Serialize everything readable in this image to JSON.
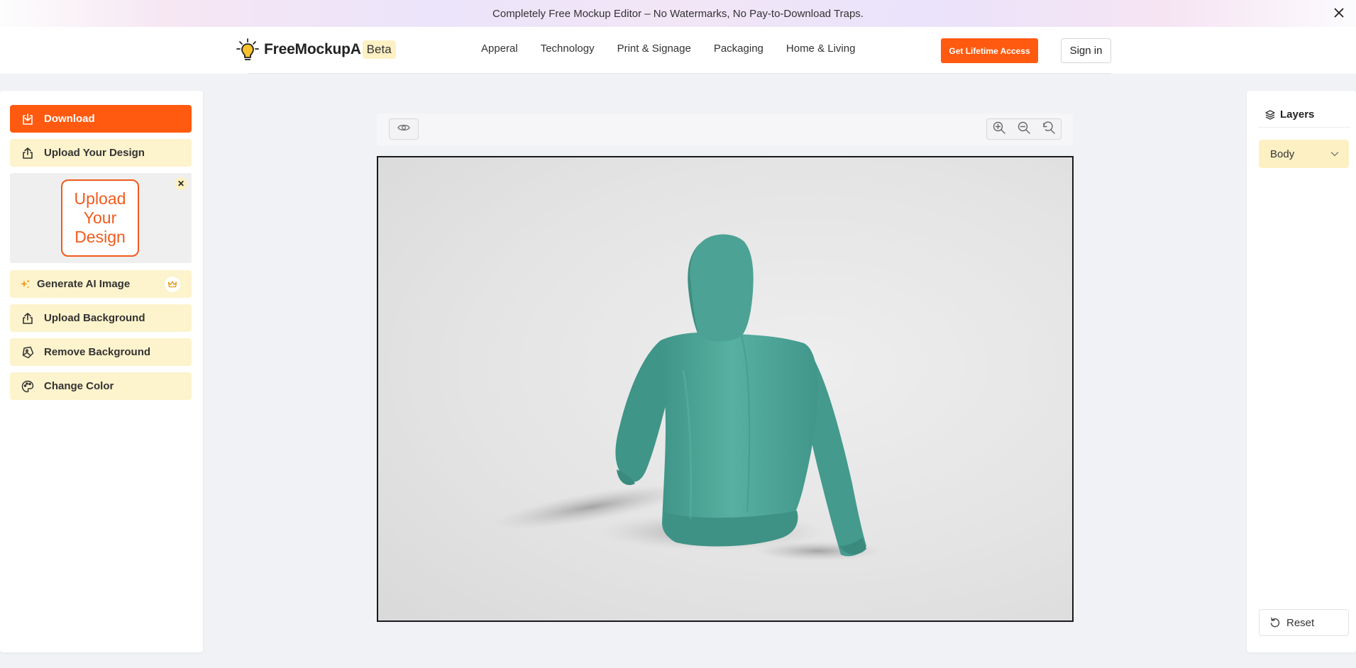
{
  "announcement": {
    "text": "Completely Free Mockup Editor – No Watermarks, No Pay-to-Download Traps."
  },
  "header": {
    "logo_text": "FreeMockupA",
    "beta_label": "Beta",
    "nav": [
      "Apperal",
      "Technology",
      "Print & Signage",
      "Packaging",
      "Home & Living"
    ],
    "lifetime_label": "Get Lifetime Access",
    "signin_label": "Sign in"
  },
  "left_panel": {
    "download_label": "Download",
    "upload_design_label": "Upload Your Design",
    "preview_card_text": "Upload Your Design",
    "generate_ai_label": "Generate AI Image",
    "upload_background_label": "Upload Background",
    "remove_background_label": "Remove Background",
    "change_color_label": "Change Color"
  },
  "right_panel": {
    "layers_title": "Layers",
    "selected_layer": "Body",
    "reset_label": "Reset"
  },
  "colors": {
    "accent": "#ff5a0f",
    "button_bg": "#fdf3cc",
    "hoodie": "#4ea89a",
    "canvas_bg": "#e4e4e4"
  },
  "icons": [
    "lightbulb-logo-icon",
    "close-icon",
    "download-icon",
    "upload-icon",
    "sparkle-icon",
    "crown-icon",
    "image-remove-icon",
    "palette-icon",
    "eye-icon",
    "zoom-in-icon",
    "zoom-out-icon",
    "reset-zoom-icon",
    "layers-icon",
    "chevron-down-icon",
    "reset-icon"
  ]
}
